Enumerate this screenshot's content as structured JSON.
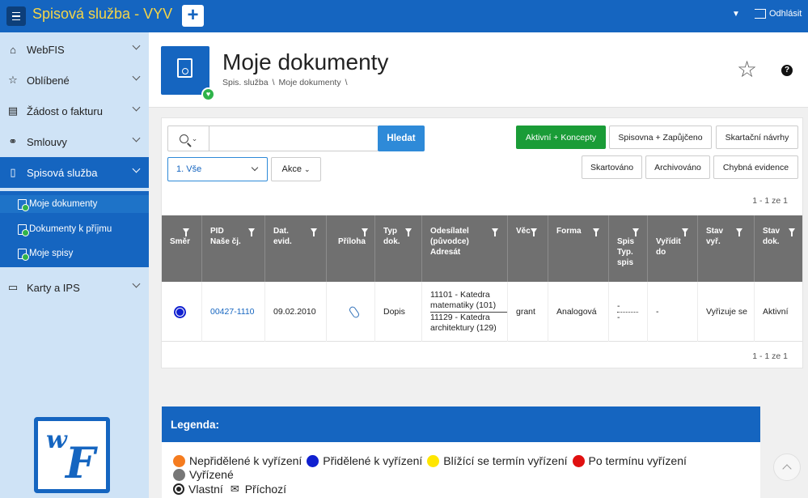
{
  "app": {
    "title": "Spisová služba - VYV",
    "add_label": "+",
    "user_caret": "▼",
    "logout_label": "Odhlásit"
  },
  "sidebar": {
    "items": [
      {
        "label": "WebFIS",
        "icon": "home-icon"
      },
      {
        "label": "Oblíbené",
        "icon": "star-icon"
      },
      {
        "label": "Žádost o fakturu",
        "icon": "invoice-icon"
      },
      {
        "label": "Smlouvy",
        "icon": "handshake-icon"
      },
      {
        "label": "Spisová služba",
        "icon": "document-icon"
      },
      {
        "label": "Karty a IPS",
        "icon": "card-icon"
      }
    ],
    "submenu": [
      {
        "label": "Moje dokumenty"
      },
      {
        "label": "Dokumenty k příjmu"
      },
      {
        "label": "Moje spisy"
      }
    ]
  },
  "header": {
    "title": "Moje dokumenty",
    "breadcrumb": [
      "Spis. služba",
      "\\",
      "Moje dokumenty",
      "\\"
    ],
    "favorite_glyph": "☆",
    "help_glyph": "?"
  },
  "toolbar": {
    "search_placeholder": "",
    "search_button": "Hledat",
    "filters_row1": [
      "Aktivní + Koncepty",
      "Spisovna + Zapůjčeno",
      "Skartační návrhy"
    ],
    "filters_row2": [
      "Skartováno",
      "Archivováno",
      "Chybná evidence"
    ],
    "view_select": "1. Vše",
    "actions_button": "Akce"
  },
  "pager": {
    "top": "1 - 1 ze 1",
    "bottom": "1 - 1 ze 1"
  },
  "table": {
    "columns": [
      {
        "line1": "Směr",
        "line2": ""
      },
      {
        "line1": "PID",
        "line2": "Naše čj."
      },
      {
        "line1": "Dat.",
        "line2": "evid."
      },
      {
        "line1": "Příloha",
        "line2": ""
      },
      {
        "line1": "Typ",
        "line2": "dok."
      },
      {
        "line1": "Odesílatel",
        "line2": "(původce)",
        "line3": "Adresát"
      },
      {
        "line1": "Věc",
        "line2": ""
      },
      {
        "line1": "Forma",
        "line2": ""
      },
      {
        "line1": "Spis",
        "line2": "Typ.",
        "line3": "spis"
      },
      {
        "line1": "Vyřídit",
        "line2": "do"
      },
      {
        "line1": "Stav",
        "line2": "vyř."
      },
      {
        "line1": "Stav",
        "line2": "dok."
      }
    ],
    "rows": [
      {
        "pid": "00427-1110",
        "date": "09.02.2010",
        "type": "Dopis",
        "sender": "11101 - Katedra matematiky (101)",
        "recipient": "11129 - Katedra architektury (129)",
        "subject": "grant",
        "form": "Analogová",
        "spis_line1": "-",
        "spis_line2": "-",
        "due": "-",
        "status_vyr": "Vyřizuje se",
        "status_dok": "Aktivní"
      }
    ]
  },
  "legend": {
    "title": "Legenda:",
    "items": [
      {
        "label": "Nepřidělené k vyřízení",
        "color": "#f57c1f"
      },
      {
        "label": "Přidělené k vyřízení",
        "color": "#1020d0"
      },
      {
        "label": "Blížící se termín vyřízení",
        "color": "#ffe600"
      },
      {
        "label": "Po termínu vyřízení",
        "color": "#e01010"
      },
      {
        "label": "Vyřízené",
        "color": "#777777"
      }
    ],
    "direction": {
      "own": "Vlastní",
      "incoming": "Příchozí"
    }
  }
}
